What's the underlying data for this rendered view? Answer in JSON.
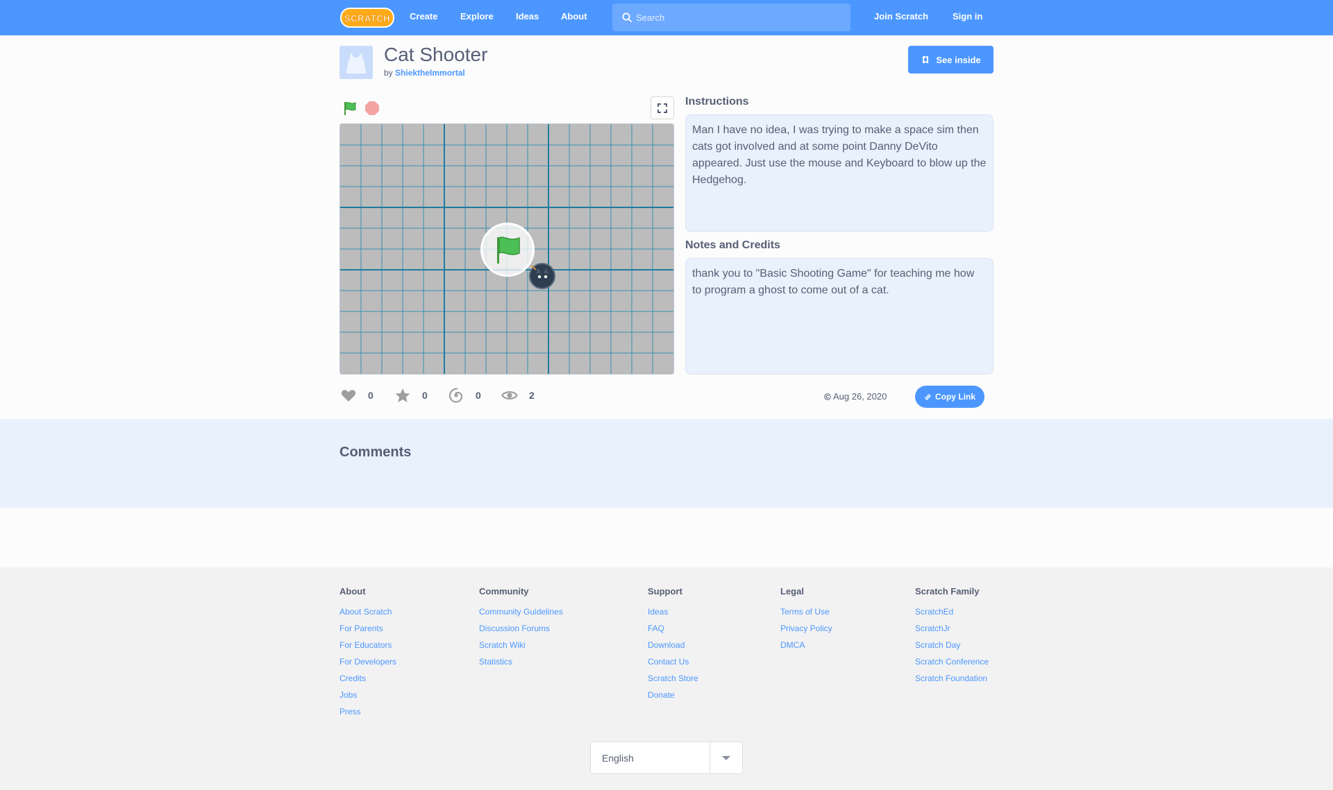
{
  "nav": {
    "logo_text": "SCRATCH",
    "links": [
      "Create",
      "Explore",
      "Ideas",
      "About"
    ],
    "search_placeholder": "Search",
    "join": "Join Scratch",
    "sign_in": "Sign in",
    "brand_color": "#4c97ff"
  },
  "project": {
    "title": "Cat Shooter",
    "by_prefix": "by",
    "author": "ShiektheImmortal",
    "see_inside": "See inside"
  },
  "instructions": {
    "heading": "Instructions",
    "text": "Man I have no idea, I was trying to make a space sim then cats got involved and at some point Danny DeVito appeared. Just use the mouse and Keyboard to blow up the Hedgehog."
  },
  "notes": {
    "heading": "Notes and Credits",
    "text": "thank you to \"Basic Shooting Game\" for teaching me how to program a ghost to come out of a cat."
  },
  "stats": {
    "loves": "0",
    "favorites": "0",
    "remixes": "0",
    "views": "2"
  },
  "date": "Aug 26, 2020",
  "copy_link": "Copy Link",
  "comments": {
    "title": "Comments"
  },
  "footer": {
    "columns": [
      {
        "title": "About",
        "links": [
          "About Scratch",
          "For Parents",
          "For Educators",
          "For Developers",
          "Credits",
          "Jobs",
          "Press"
        ]
      },
      {
        "title": "Community",
        "links": [
          "Community Guidelines",
          "Discussion Forums",
          "Scratch Wiki",
          "Statistics"
        ]
      },
      {
        "title": "Support",
        "links": [
          "Ideas",
          "FAQ",
          "Download",
          "Contact Us",
          "Scratch Store",
          "Donate"
        ]
      },
      {
        "title": "Legal",
        "links": [
          "Terms of Use",
          "Privacy Policy",
          "DMCA"
        ]
      },
      {
        "title": "Scratch Family",
        "links": [
          "ScratchEd",
          "ScratchJr",
          "Scratch Day",
          "Scratch Conference",
          "Scratch Foundation"
        ]
      }
    ],
    "language": "English"
  }
}
